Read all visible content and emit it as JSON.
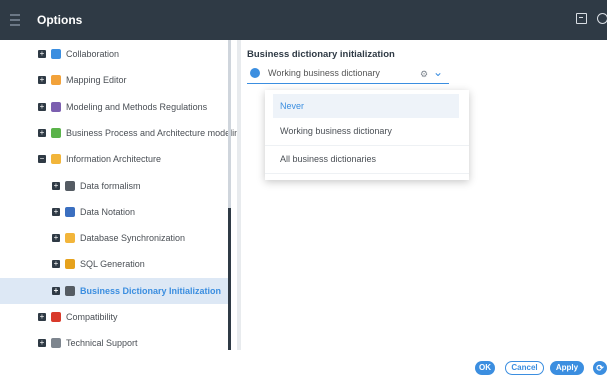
{
  "window": {
    "title": "Options"
  },
  "tree": {
    "items": [
      {
        "label": "Collaboration",
        "toggle": "+",
        "icon": "collaboration-icon",
        "color": "#3b8ee0",
        "indent": 0
      },
      {
        "label": "Mapping Editor",
        "toggle": "+",
        "icon": "mapping-editor-icon",
        "color": "#f2a23a",
        "indent": 0
      },
      {
        "label": "Modeling and Methods Regulations",
        "toggle": "+",
        "icon": "regulations-icon",
        "color": "#7c5fb0",
        "indent": 0
      },
      {
        "label": "Business Process and Architecture modeling",
        "toggle": "+",
        "icon": "process-icon",
        "color": "#5ab34a",
        "indent": 0
      },
      {
        "label": "Information Architecture",
        "toggle": "−",
        "icon": "folder-icon",
        "color": "#f2b53a",
        "indent": 0
      },
      {
        "label": "Data formalism",
        "toggle": "+",
        "icon": "data-formalism-icon",
        "color": "#555c63",
        "indent": 1
      },
      {
        "label": "Data Notation",
        "toggle": "+",
        "icon": "data-notation-icon",
        "color": "#3b6fc0",
        "indent": 1
      },
      {
        "label": "Database Synchronization",
        "toggle": "+",
        "icon": "database-icon",
        "color": "#f2b53a",
        "indent": 1
      },
      {
        "label": "SQL Generation",
        "toggle": "+",
        "icon": "sql-icon",
        "color": "#e6a21c",
        "indent": 1
      },
      {
        "label": "Business Dictionary Initialization",
        "toggle": "+",
        "icon": "dictionary-icon",
        "color": "#555c63",
        "indent": 1,
        "selected": true
      },
      {
        "label": "Compatibility",
        "toggle": "+",
        "icon": "compatibility-icon",
        "color": "#d93a2b",
        "indent": 0
      },
      {
        "label": "Technical Support",
        "toggle": "+",
        "icon": "support-icon",
        "color": "#7d858e",
        "indent": 0
      }
    ]
  },
  "panel": {
    "title": "Business dictionary initialization",
    "combo": {
      "value": "Working business dictionary",
      "clear_icon": "clear-icon",
      "chevron_icon": "chevron-down-icon"
    },
    "options": [
      "Never",
      "Working business dictionary",
      "All business dictionaries"
    ],
    "highlighted_option": "Never"
  },
  "footer": {
    "ok_label": "OK",
    "cancel_label": "Cancel",
    "apply_label": "Apply",
    "refresh_icon": "refresh-icon"
  },
  "colors": {
    "accent": "#3b8ee0",
    "titlebar": "#2f3a45",
    "selected_bg": "#dde8f5"
  }
}
